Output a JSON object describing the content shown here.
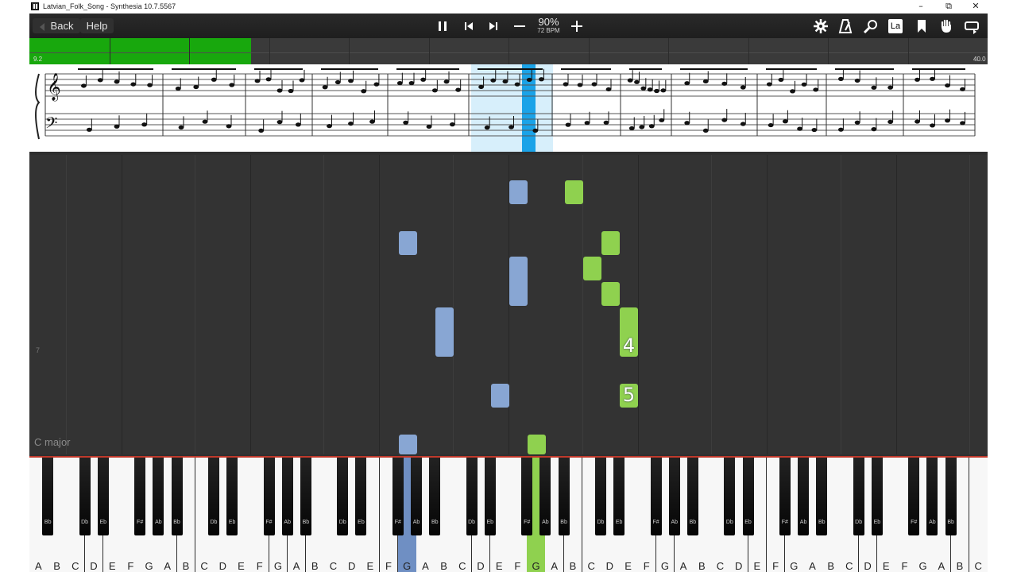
{
  "window": {
    "title": "Latvian_Folk_Song - Synthesia 10.7.5567"
  },
  "toolbar": {
    "back_label": "Back",
    "help_label": "Help",
    "tempo_percent": "90%",
    "tempo_bpm": "72 BPM",
    "label_mode_icon_text": "La"
  },
  "progress": {
    "fraction": 0.231,
    "start_label": "9.2",
    "end_label": "40.0"
  },
  "song": {
    "key_label": "C major",
    "measure_marker": "7"
  },
  "fingering": [
    "4",
    "5"
  ],
  "keyboard": {
    "white_labels": [
      "A",
      "B",
      "C",
      "D",
      "E",
      "F",
      "G",
      "A",
      "B",
      "C",
      "D",
      "E",
      "F",
      "G",
      "A",
      "B",
      "C",
      "D",
      "E",
      "F",
      "G",
      "A",
      "B",
      "C",
      "D",
      "E",
      "F",
      "G",
      "A",
      "B",
      "C",
      "D",
      "E",
      "F",
      "G",
      "A",
      "B",
      "C",
      "D",
      "E",
      "F",
      "G",
      "A",
      "B",
      "C",
      "D",
      "E",
      "F",
      "G",
      "A",
      "B",
      "C"
    ],
    "black_labels": [
      "Bb",
      "Db",
      "Eb",
      "F#",
      "Ab",
      "Bb",
      "Db",
      "Eb",
      "F#",
      "Ab",
      "Bb",
      "Db",
      "Eb",
      "F#",
      "Ab",
      "Bb",
      "Db",
      "Eb",
      "F#",
      "Ab",
      "Bb",
      "Db",
      "Eb",
      "F#",
      "Ab",
      "Bb",
      "Db",
      "Eb",
      "F#",
      "Ab",
      "Bb",
      "Db",
      "Eb",
      "F#",
      "Ab",
      "Bb"
    ],
    "pressed": [
      {
        "label": "G",
        "hand": "left"
      },
      {
        "label": "G",
        "hand": "right"
      }
    ]
  },
  "colors": {
    "left_hand": "#88a6d3",
    "right_hand": "#8fd14f",
    "progress": "#18a80d",
    "highlight": "#1aa3e8"
  }
}
